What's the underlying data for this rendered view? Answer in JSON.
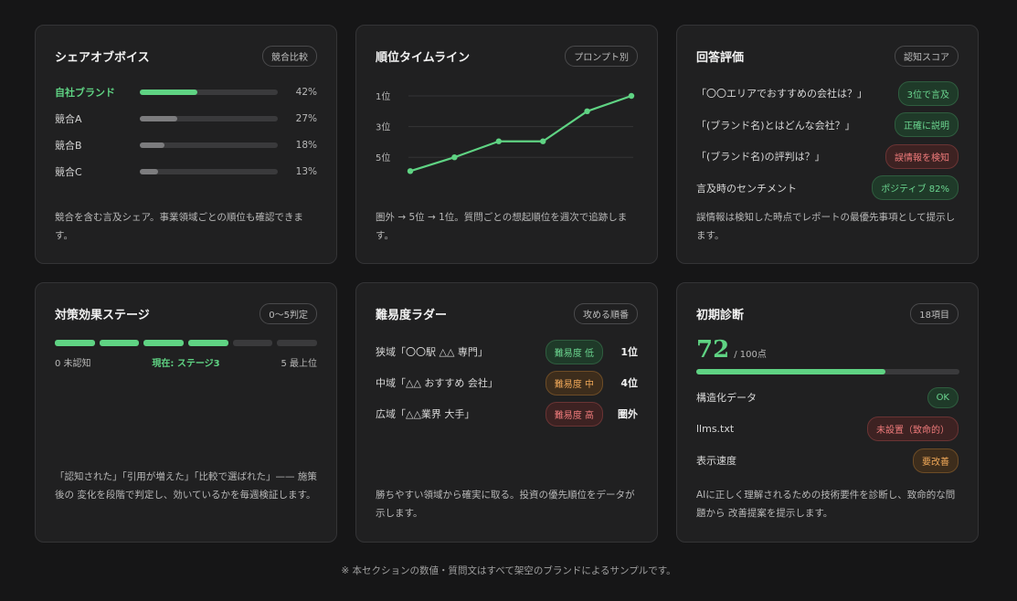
{
  "sov": {
    "title": "シェアオブボイス",
    "pill": "競合比較",
    "rows": [
      {
        "name": "自社ブランド",
        "value": 42,
        "pct": "42%"
      },
      {
        "name": "競合A",
        "value": 27,
        "pct": "27%"
      },
      {
        "name": "競合B",
        "value": 18,
        "pct": "18%"
      },
      {
        "name": "競合C",
        "value": 13,
        "pct": "13%"
      }
    ],
    "desc": "競合を含む言及シェア。事業領域ごとの順位も確認できます。"
  },
  "timeline": {
    "title": "順位タイムライン",
    "pill": "プロンプト別",
    "desc": "圏外 → 5位 → 1位。質問ごとの想起順位を週次で追跡します。"
  },
  "chart_data": {
    "type": "line",
    "y_ticks": [
      "1位",
      "3位",
      "5位"
    ],
    "y_tick_values": [
      1,
      3,
      5
    ],
    "values": [
      5.9,
      5.0,
      3.96,
      3.96,
      2.0,
      1.0
    ],
    "ylim": [
      1,
      6
    ],
    "y_inverted": true,
    "grid": true,
    "color": "#5fd383"
  },
  "answers": {
    "title": "回答評価",
    "pill": "認知スコア",
    "rows": [
      {
        "q": "「〇〇エリアでおすすめの会社は？」",
        "tag": "3位で言及",
        "tone": "green"
      },
      {
        "q": "「(ブランド名)とはどんな会社？」",
        "tag": "正確に説明",
        "tone": "green"
      },
      {
        "q": "「(ブランド名)の評判は？」",
        "tag": "誤情報を検知",
        "tone": "red"
      },
      {
        "q": "言及時のセンチメント",
        "tag": "ポジティブ 82%",
        "tone": "green"
      }
    ],
    "desc": "誤情報は検知した時点でレポートの最優先事項として提示します。"
  },
  "stage": {
    "title": "対策効果ステージ",
    "pill": "0〜5判定",
    "current": 3,
    "total": 6,
    "label_start": "0 未認知",
    "label_now": "現在: ステージ3",
    "label_end": "5 最上位",
    "desc": "「認知された」「引用が増えた」「比較で選ばれた」—— 施策後の 変化を段階で判定し、効いているかを毎週検証します。"
  },
  "ladder": {
    "title": "難易度ラダー",
    "pill": "攻める順番",
    "rows": [
      {
        "name": "狭域「〇〇駅 △△ 専門」",
        "tag": "難易度 低",
        "tone": "green",
        "rank": "1位"
      },
      {
        "name": "中域「△△ おすすめ 会社」",
        "tag": "難易度 中",
        "tone": "orange",
        "rank": "4位"
      },
      {
        "name": "広域「△△業界 大手」",
        "tag": "難易度 高",
        "tone": "red",
        "rank": "圏外"
      }
    ],
    "desc": "勝ちやすい領域から確実に取る。投資の優先順位をデータが示します。"
  },
  "diag": {
    "title": "初期診断",
    "pill": "18項目",
    "score": "72",
    "score_unit": "/ 100点",
    "score_value": 72,
    "rows": [
      {
        "name": "構造化データ",
        "tag": "OK",
        "tone": "green"
      },
      {
        "name": "llms.txt",
        "tag": "未設置（致命的）",
        "tone": "red"
      },
      {
        "name": "表示速度",
        "tag": "要改善",
        "tone": "orange"
      }
    ],
    "desc": "AIに正しく理解されるための技術要件を診断し、致命的な問題から 改善提案を提示します。"
  },
  "note": "※ 本セクションの数値・質問文はすべて架空のブランドによるサンプルです。"
}
